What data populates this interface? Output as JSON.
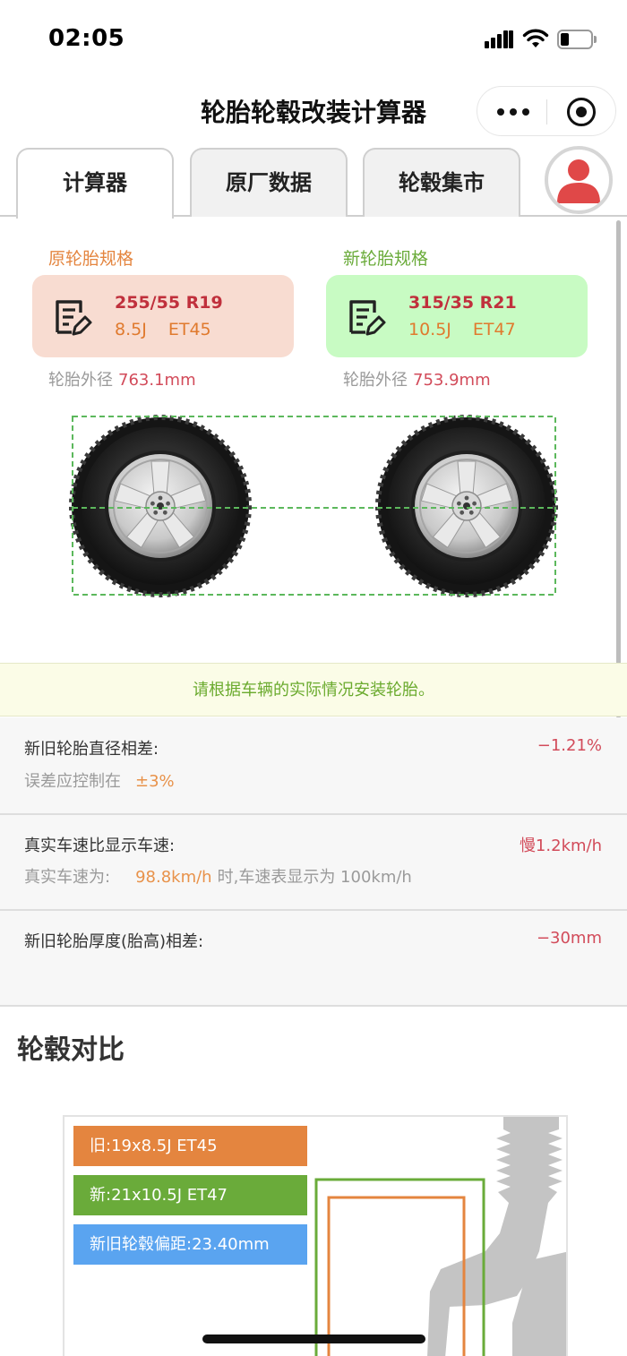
{
  "status_bar": {
    "time": "02:05"
  },
  "nav": {
    "title": "轮胎轮毂改装计算器"
  },
  "tabs": [
    {
      "label": "计算器",
      "active": true
    },
    {
      "label": "原厂数据",
      "active": false
    },
    {
      "label": "轮毂集市",
      "active": false
    }
  ],
  "original": {
    "label": "原轮胎规格",
    "size": "255/55 R19",
    "width": "8.5J",
    "et": "ET45",
    "diameter_label": "轮胎外径",
    "diameter": "763.1mm"
  },
  "new": {
    "label": "新轮胎规格",
    "size": "315/35 R21",
    "width": "10.5J",
    "et": "ET47",
    "diameter_label": "轮胎外径",
    "diameter": "753.9mm"
  },
  "notice": "请根据车辆的实际情况安装轮胎。",
  "results": {
    "diameter_diff": {
      "title": "新旧轮胎直径相差:",
      "value": "−1.21%",
      "sub_label": "误差应控制在",
      "sub_value": "±3%"
    },
    "speed": {
      "title": "真实车速比显示车速:",
      "value": "慢1.2km/h",
      "sub_label": "真实车速为:",
      "sub_value": "98.8km/h",
      "sub_suffix": "时,车速表显示为 100km/h"
    },
    "thickness": {
      "title": "新旧轮胎厚度(胎高)相差:",
      "value": "−30mm"
    }
  },
  "rim_compare": {
    "title": "轮毂对比",
    "old": "旧:19x8.5J ET45",
    "new": "新:21x10.5J ET47",
    "offset": "新旧轮毂偏距:23.40mm"
  },
  "colors": {
    "old_accent": "#e4853f",
    "new_accent": "#6aab3a",
    "offset_accent": "#5aa4f0",
    "old_card_bg": "#f8dcd1",
    "new_card_bg": "#c8fbc3",
    "negative": "#d24b5a"
  },
  "icons": [
    "signal-icon",
    "wifi-icon",
    "battery-icon",
    "more-icon",
    "record-icon",
    "avatar-icon",
    "document-edit-icon",
    "tire-icon",
    "suspension-strut-icon"
  ]
}
